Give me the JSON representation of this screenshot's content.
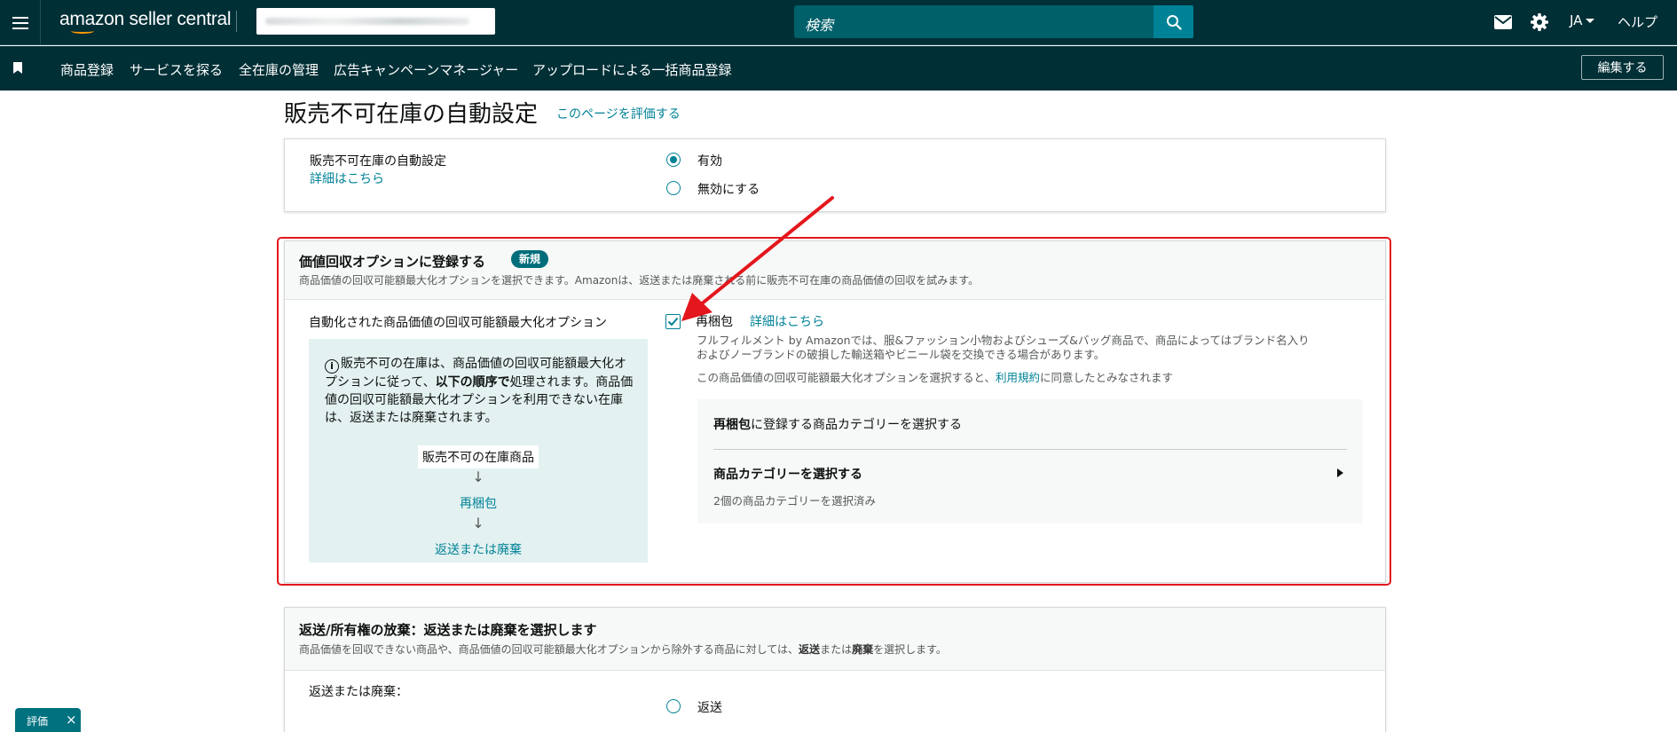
{
  "topbar": {
    "logo_text": "amazon seller central",
    "store_selector_value": "",
    "search_placeholder": "検索",
    "language": "JA",
    "help_label": "ヘルプ"
  },
  "navbar": {
    "items": [
      {
        "label": "商品登録"
      },
      {
        "label": "サービスを探る"
      },
      {
        "label": "全在庫の管理"
      },
      {
        "label": "広告キャンペーンマネージャー"
      },
      {
        "label": "アップロードによる一括商品登録"
      }
    ],
    "edit_label": "編集する"
  },
  "page": {
    "title": "販売不可在庫の自動設定",
    "rate_link": "このページを評価する"
  },
  "auto_setting": {
    "label": "販売不可在庫の自動設定",
    "details_link": "詳細はこちら",
    "options": [
      {
        "label": "有効",
        "selected": true
      },
      {
        "label": "無効にする",
        "selected": false
      }
    ]
  },
  "value_recovery": {
    "title": "価値回収オプションに登録する",
    "badge": "新規",
    "description": "商品価値の回収可能額最大化オプションを選択できます。Amazonは、返送または廃棄される前に販売不可在庫の商品価値の回収を試みます。",
    "left_label": "自動化された商品価値の回収可能額最大化オプション",
    "info": {
      "text_before_bold": "販売不可の在庫は、商品価値の回収可能額最大化オプションに従って、",
      "bold": "以下の順序で",
      "text_after_bold": "処理されます。商品価値の回収可能額最大化オプションを利用できない在庫は、返送または廃棄されます。",
      "flow": [
        "販売不可の在庫商品",
        "再梱包",
        "返送または廃棄"
      ]
    },
    "repack": {
      "label": "再梱包",
      "checked": true,
      "details_link": "詳細はこちら",
      "desc_line1": "フルフィルメント by Amazonでは、服&ファッション小物およびシューズ&バッグ商品で、商品によってはブランド名入り",
      "desc_line2": "およびノーブランドの破損した輸送箱やビニール袋を交換できる場合があります。",
      "terms_before": "この商品価値の回収可能額最大化オプションを選択すると、",
      "terms_link": "利用規約",
      "terms_after": "に同意したとみなされます",
      "category_heading_bold": "再梱包",
      "category_heading_rest": "に登録する商品カテゴリーを選択する",
      "select_category": "商品カテゴリーを選択する",
      "selected_count": "2個の商品カテゴリーを選択済み"
    }
  },
  "return_section": {
    "title": "返送/所有権の放棄：返送または廃棄を選択します",
    "desc_before": "商品価値を回収できない商品や、商品価値の回収可能額最大化オプションから除外する商品に対しては、",
    "desc_bold1": "返送",
    "desc_mid": "または",
    "desc_bold2": "廃棄",
    "desc_after": "を選択します。",
    "label": "返送または廃棄：",
    "option": "返送"
  },
  "feedback_tab": {
    "label": "評価",
    "close": "×"
  },
  "colors": {
    "header_bg": "#002f36",
    "accent": "#008296",
    "highlight": "#e3171d"
  }
}
